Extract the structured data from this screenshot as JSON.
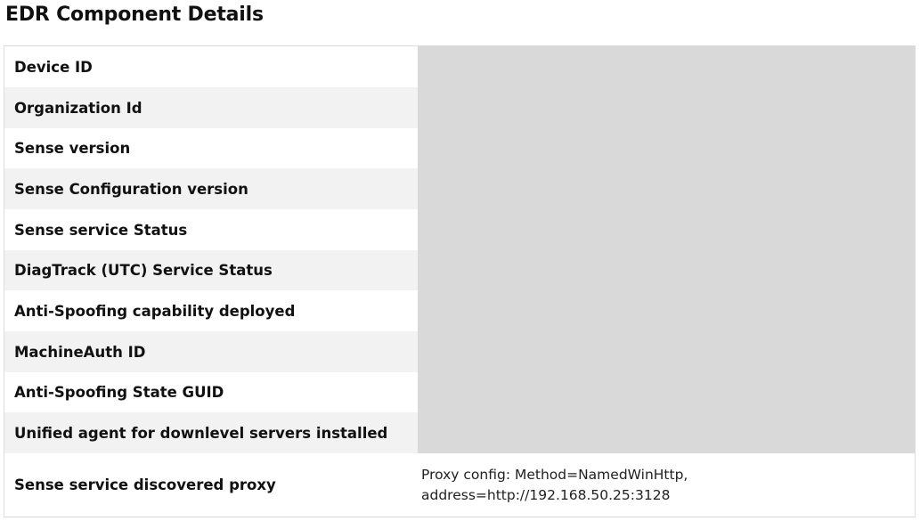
{
  "page": {
    "title": "EDR Component Details"
  },
  "rows": [
    {
      "label": "Device ID",
      "value": ""
    },
    {
      "label": "Organization Id",
      "value": ""
    },
    {
      "label": "Sense version",
      "value": ""
    },
    {
      "label": "Sense Configuration version",
      "value": ""
    },
    {
      "label": "Sense service Status",
      "value": ""
    },
    {
      "label": "DiagTrack (UTC) Service Status",
      "value": ""
    },
    {
      "label": "Anti-Spoofing capability deployed",
      "value": ""
    },
    {
      "label": "MachineAuth ID",
      "value": ""
    },
    {
      "label": "Anti-Spoofing State GUID",
      "value": ""
    },
    {
      "label": "Unified agent for downlevel servers installed",
      "value": ""
    },
    {
      "label": "Sense service discovered proxy",
      "value_line1": "Proxy config: Method=NamedWinHttp,",
      "value_line2": "address=http://192.168.50.25:3128"
    }
  ],
  "colors": {
    "redaction": "#d9d9d9",
    "row_alt": "#f2f2f2",
    "border": "#dcdcdc"
  }
}
